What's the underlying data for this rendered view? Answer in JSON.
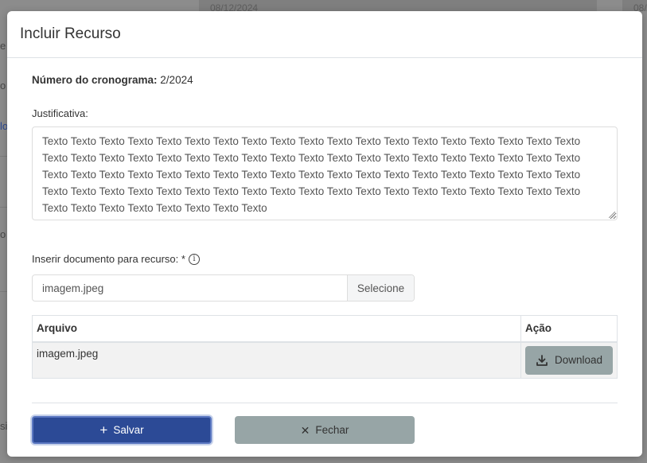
{
  "background": {
    "dates": [
      "08/12/2024",
      "08/"
    ],
    "fragments": [
      "e c",
      "o",
      "lo",
      "o",
      "sif"
    ]
  },
  "modal": {
    "title": "Incluir Recurso",
    "cronograma": {
      "label": "Número do cronograma:",
      "value": "2/2024"
    },
    "justificativa": {
      "label": "Justificativa:",
      "value": "Texto Texto Texto Texto Texto Texto Texto Texto Texto Texto Texto Texto Texto Texto Texto Texto Texto Texto Texto Texto Texto Texto Texto Texto Texto Texto Texto Texto Texto Texto Texto Texto Texto Texto Texto Texto Texto Texto Texto Texto Texto Texto Texto Texto Texto Texto Texto Texto Texto Texto Texto Texto Texto Texto Texto Texto Texto Texto Texto Texto Texto Texto Texto Texto Texto Texto Texto Texto Texto Texto Texto Texto Texto Texto Texto Texto Texto Texto Texto Texto Texto Texto Texto Texto"
    },
    "documento": {
      "label": "Inserir documento para recurso: *",
      "info_icon": "info-circle-icon",
      "file_value": "imagem.jpeg",
      "select_label": "Selecione"
    },
    "table": {
      "headers": [
        "Arquivo",
        "Ação"
      ],
      "rows": [
        {
          "arquivo": "imagem.jpeg",
          "action_label": "Download",
          "action_icon": "download-icon"
        }
      ]
    },
    "buttons": {
      "save": {
        "label": "Salvar",
        "icon": "plus-icon",
        "color": "#2c4a96"
      },
      "close": {
        "label": "Fechar",
        "icon": "close-icon",
        "color": "#97a5a6"
      }
    }
  }
}
